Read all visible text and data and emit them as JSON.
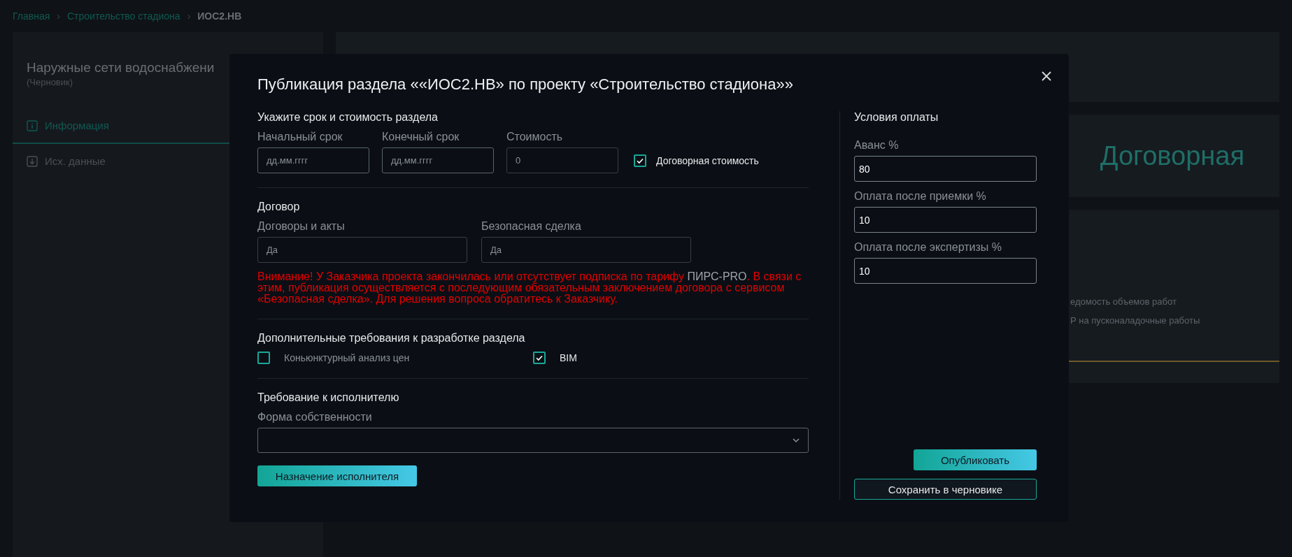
{
  "breadcrumb_separator": "›",
  "breadcrumbs": [
    {
      "label": "Главная",
      "current": false
    },
    {
      "label": "Строительство стадиона",
      "current": false
    },
    {
      "label": "ИОС2.НВ",
      "current": true
    }
  ],
  "sidebar": {
    "title": "Наружные сети водоснабжени",
    "status": "(Черновик)",
    "tabs": [
      {
        "label": "Информация",
        "kind": "info",
        "selected": true
      },
      {
        "label": "Исх. данные",
        "kind": "import",
        "selected": false
      }
    ]
  },
  "main": {
    "price_label": "Договорная",
    "list_items": [
      "едомость объемов работ",
      "Р на пусконаладочные работы"
    ]
  },
  "modal": {
    "title": "Публикация раздела ««ИОС2.НВ» по проекту «Строительство стадиона»»",
    "terms": {
      "heading": "Укажите срок и стоимость раздела",
      "fields": [
        {
          "label": "Начальный срок",
          "placeholder": "дд.мм.гггг",
          "disabled": false
        },
        {
          "label": "Конечный срок",
          "placeholder": "дд.мм.гггг",
          "disabled": false
        },
        {
          "label": "Стоимость",
          "placeholder": "0",
          "disabled": true
        }
      ],
      "negotiable": {
        "label": "Договорная стоимость",
        "checked": true
      }
    },
    "contract": {
      "heading": "Договор",
      "fields": [
        {
          "label": "Договоры и акты",
          "value": "Да",
          "disabled": true
        },
        {
          "label": "Безопасная сделка",
          "value": "Да",
          "disabled": true
        }
      ],
      "warning": [
        {
          "text": "Внимание! У Заказчика проекта закончилась или отсутствует подписка по тарифу ",
          "kind": "alert"
        },
        {
          "text": "ПИРС-PRO",
          "kind": "plain"
        },
        {
          "text": ". В связи с этим, публикация осуществляется с последующим обязательным заключением договора с сервисом «Безопасная сделка». Для решения вопроса обратитесь к Заказчику.",
          "kind": "alert"
        }
      ]
    },
    "extras": {
      "heading": "Дополнительные требования к разработке раздела",
      "options": [
        {
          "label": "Коньюнктурный анализ цен",
          "checked": false
        },
        {
          "label": "BIM",
          "checked": true
        }
      ]
    },
    "executor": {
      "heading": "Требование к исполнителю",
      "select_label": "Форма собственности",
      "assign_button": "Назначение исполнителя"
    },
    "payment": {
      "heading": "Условия оплаты",
      "fields": [
        {
          "label": "Аванс %",
          "value": "80"
        },
        {
          "label": "Оплата после приемки %",
          "value": "10"
        },
        {
          "label": "Оплата после экспертизы %",
          "value": "10"
        }
      ]
    },
    "buttons": [
      {
        "label": "Опубликовать",
        "kind": "primary"
      },
      {
        "label": "Сохранить в черновике",
        "kind": "outline"
      }
    ]
  }
}
